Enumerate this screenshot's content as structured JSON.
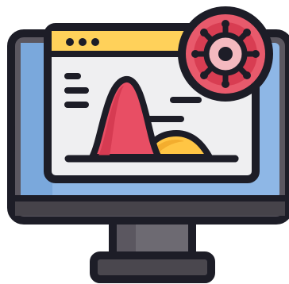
{
  "illustration": {
    "kind": "icon",
    "subject": "monitor-with-virus-chart",
    "icons": [
      "monitor-icon",
      "browser-window-icon",
      "virus-icon",
      "bell-curve-chart-icon"
    ]
  },
  "colors": {
    "outline": "#1d1d27",
    "monitor_frame": "#5b5760",
    "monitor_frame_shadow": "#46434a",
    "screen": "#8eb7e6",
    "screen_shade": "#7aa8dc",
    "window_body": "#efeff1",
    "window_header": "#ffd15a",
    "stand": "#6d6a72",
    "base": "#4a474e",
    "virus_outer": "#e85a6c",
    "virus_inner": "#d83d52",
    "virus_core": "#f4b9bf",
    "curve_red": "#e84e64",
    "curve_red_shade": "#d63b52",
    "curve_yellow": "#ffc544",
    "curve_yellow_shade": "#f3ad2e",
    "text_lines": "#1d1d27"
  }
}
